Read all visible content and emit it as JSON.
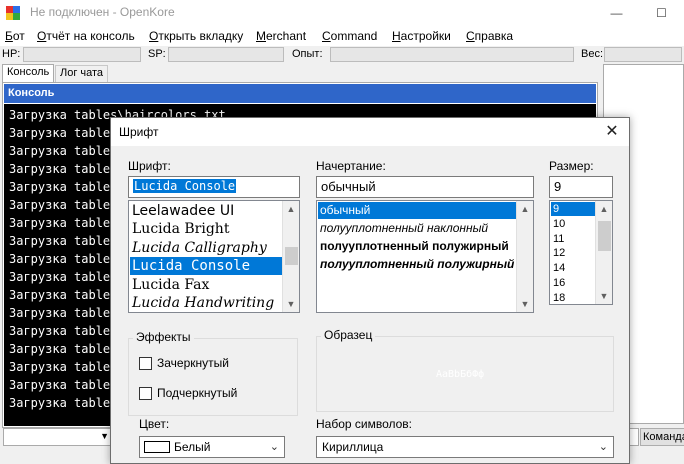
{
  "window": {
    "title": "Не подключен - OpenKore",
    "minimize_glyph": "—",
    "maximize_glyph": "☐",
    "icon_colors": [
      "#e8312b",
      "#2b6fe8",
      "#f2c41d",
      "#35a83a"
    ]
  },
  "menu": [
    {
      "pre": "",
      "key": "Б",
      "post": "от"
    },
    {
      "pre": "",
      "key": "О",
      "post": "тчёт на консоль"
    },
    {
      "pre": "",
      "key": "О",
      "post": "ткрыть вкладку"
    },
    {
      "pre": "",
      "key": "M",
      "post": "erchant"
    },
    {
      "pre": "",
      "key": "C",
      "post": "ommand"
    },
    {
      "pre": "",
      "key": "Н",
      "post": "астройки"
    },
    {
      "pre": "",
      "key": "С",
      "post": "правка"
    }
  ],
  "stats": {
    "hp_label": "HP:",
    "sp_label": "SP:",
    "exp_label": "Опыт:",
    "weight_label": "Вес:"
  },
  "tabs": {
    "console": "Консоль",
    "chatlog": "Лог чата"
  },
  "console": {
    "header": "Консоль",
    "lines": [
      "Загрузка tables\\haircolors.txt...",
      "Загрузка tables",
      "Загрузка tables",
      "Загрузка tables",
      "Загрузка tables",
      "Загрузка tables",
      "Загрузка tables",
      "Загрузка tables",
      "Загрузка tables",
      "Загрузка tables",
      "Загрузка tables",
      "Загрузка tables",
      "Загрузка tables",
      "Загрузка tables",
      "Загрузка tables",
      "Загрузка tables",
      "Загрузка tables"
    ]
  },
  "command_button": "Команда",
  "dialog": {
    "title": "Шрифт",
    "close_glyph": "✕",
    "font_label": "Шрифт:",
    "font_value": "Lucida Console",
    "font_list": [
      {
        "name": "Leelawadee UI",
        "family": "DejaVu Sans",
        "style": "normal",
        "selected": false
      },
      {
        "name": "Lucida Bright",
        "family": "DejaVu Serif",
        "style": "normal",
        "selected": false
      },
      {
        "name": "Lucida Calligraphy",
        "family": "DejaVu Serif",
        "style": "italic",
        "selected": false
      },
      {
        "name": "Lucida Console",
        "family": "DejaVu Sans Mono",
        "style": "normal",
        "selected": true
      },
      {
        "name": "Lucida Fax",
        "family": "DejaVu Serif",
        "style": "normal",
        "selected": false
      },
      {
        "name": "Lucida Handwriting",
        "family": "DejaVu Serif",
        "style": "italic",
        "selected": false
      }
    ],
    "style_label": "Начертание:",
    "style_value": "обычный",
    "style_list": [
      {
        "name": "обычный",
        "weight": "normal",
        "style": "normal",
        "selected": true
      },
      {
        "name": "полууплотненный наклонный",
        "weight": "normal",
        "style": "italic",
        "selected": false
      },
      {
        "name": "полууплотненный полужирный",
        "weight": "bold",
        "style": "normal",
        "selected": false
      },
      {
        "name": "полууплотненный полужирный",
        "weight": "bold",
        "style": "italic",
        "selected": false
      }
    ],
    "size_label": "Размер:",
    "size_value": "9",
    "size_list": [
      {
        "name": "9",
        "selected": true
      },
      {
        "name": "10",
        "selected": false
      },
      {
        "name": "11",
        "selected": false
      },
      {
        "name": "12",
        "selected": false
      },
      {
        "name": "14",
        "selected": false
      },
      {
        "name": "16",
        "selected": false
      },
      {
        "name": "18",
        "selected": false
      }
    ],
    "effects_label": "Эффекты",
    "strikeout_label": "Зачеркнутый",
    "underline_label": "Подчеркнутый",
    "color_label": "Цвет:",
    "color_value": "Белый",
    "sample_label": "Образец",
    "sample_text": "AaBbБбФф",
    "charset_label": "Набор символов:",
    "charset_value": "Кириллица"
  },
  "colors": {
    "selection": "#0078d7",
    "console_header": "#2f66c9",
    "console_bg": "#000000"
  }
}
